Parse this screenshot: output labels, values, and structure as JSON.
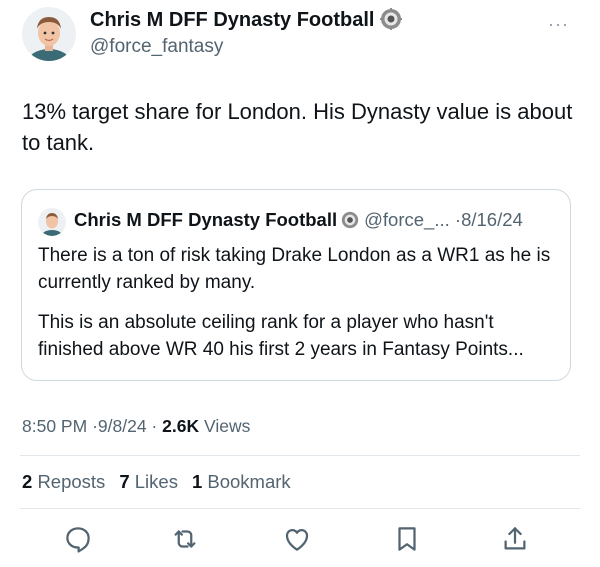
{
  "author": {
    "name": "Chris M DFF Dynasty Football",
    "handle": "@force_fantasy"
  },
  "more_label": "···",
  "tweet_text": "13% target share for London. His Dynasty value is about to tank.",
  "quote": {
    "name": "Chris M DFF Dynasty Football",
    "handle": "@force_...",
    "separator": "·",
    "date": "8/16/24",
    "paragraph_1": "There is a ton of risk taking Drake London as a WR1 as he is currently ranked by many.",
    "paragraph_2": "This is an absolute ceiling rank for a player who hasn't finished above WR 40 his first 2 years in Fantasy Points..."
  },
  "meta": {
    "time": "8:50 PM",
    "dot1": "·",
    "date": "9/8/24",
    "dot2": "·",
    "views_count": "2.6K",
    "views_label": "Views"
  },
  "stats": {
    "reposts_count": "2",
    "reposts_label": "Reposts",
    "likes_count": "7",
    "likes_label": "Likes",
    "bookmarks_count": "1",
    "bookmarks_label": "Bookmark"
  },
  "actions": [
    "reply-icon",
    "repost-icon",
    "like-icon",
    "bookmark-icon",
    "share-icon"
  ],
  "colors": {
    "text": "#0f1419",
    "secondary": "#536471",
    "border": "#cfd9de",
    "icon": "#536471"
  }
}
